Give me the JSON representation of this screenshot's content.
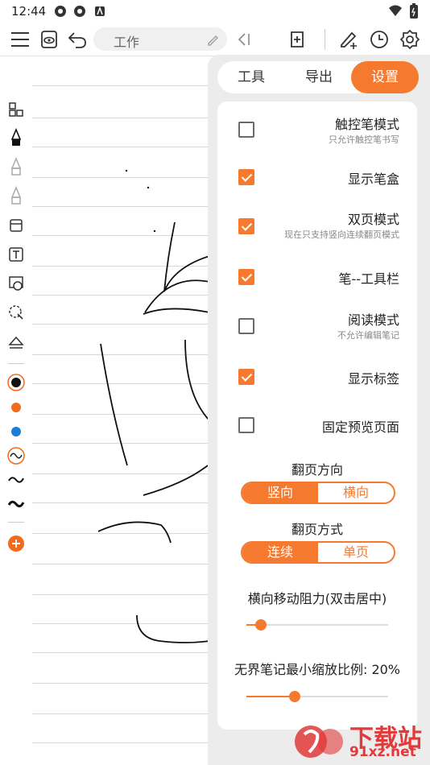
{
  "status": {
    "time": "12:44"
  },
  "toolbar": {
    "title_value": "工作"
  },
  "panel": {
    "tabs": [
      {
        "label": "工具",
        "active": false
      },
      {
        "label": "导出",
        "active": false
      },
      {
        "label": "设置",
        "active": true
      }
    ],
    "settings": [
      {
        "label": "触控笔模式",
        "sub": "只允许触控笔书写",
        "checked": false
      },
      {
        "label": "显示笔盒",
        "sub": "",
        "checked": true
      },
      {
        "label": "双页模式",
        "sub": "现在只支持竖向连续翻页模式",
        "checked": true
      },
      {
        "label": "笔--工具栏",
        "sub": "",
        "checked": true
      },
      {
        "label": "阅读模式",
        "sub": "不允许编辑笔记",
        "checked": false
      },
      {
        "label": "显示标签",
        "sub": "",
        "checked": true
      },
      {
        "label": "固定预览页面",
        "sub": "",
        "checked": false
      }
    ],
    "page_direction": {
      "label": "翻页方向",
      "options": [
        "竖向",
        "横向"
      ],
      "selected": "竖向"
    },
    "page_mode": {
      "label": "翻页方式",
      "options": [
        "连续",
        "单页"
      ],
      "selected": "连续"
    },
    "resistance": {
      "label": "横向移动阻力(双击居中)",
      "value": 0.1
    },
    "min_zoom": {
      "label": "无界笔记最小缩放比例: 20%",
      "value": 0.34
    }
  },
  "watermark": {
    "line1": "下载站",
    "line2": "91xz.net"
  },
  "colors": {
    "accent": "#f5792e",
    "pen_black": "#111111",
    "pen_orange": "#f26a1b",
    "pen_blue": "#1a7fd4"
  }
}
